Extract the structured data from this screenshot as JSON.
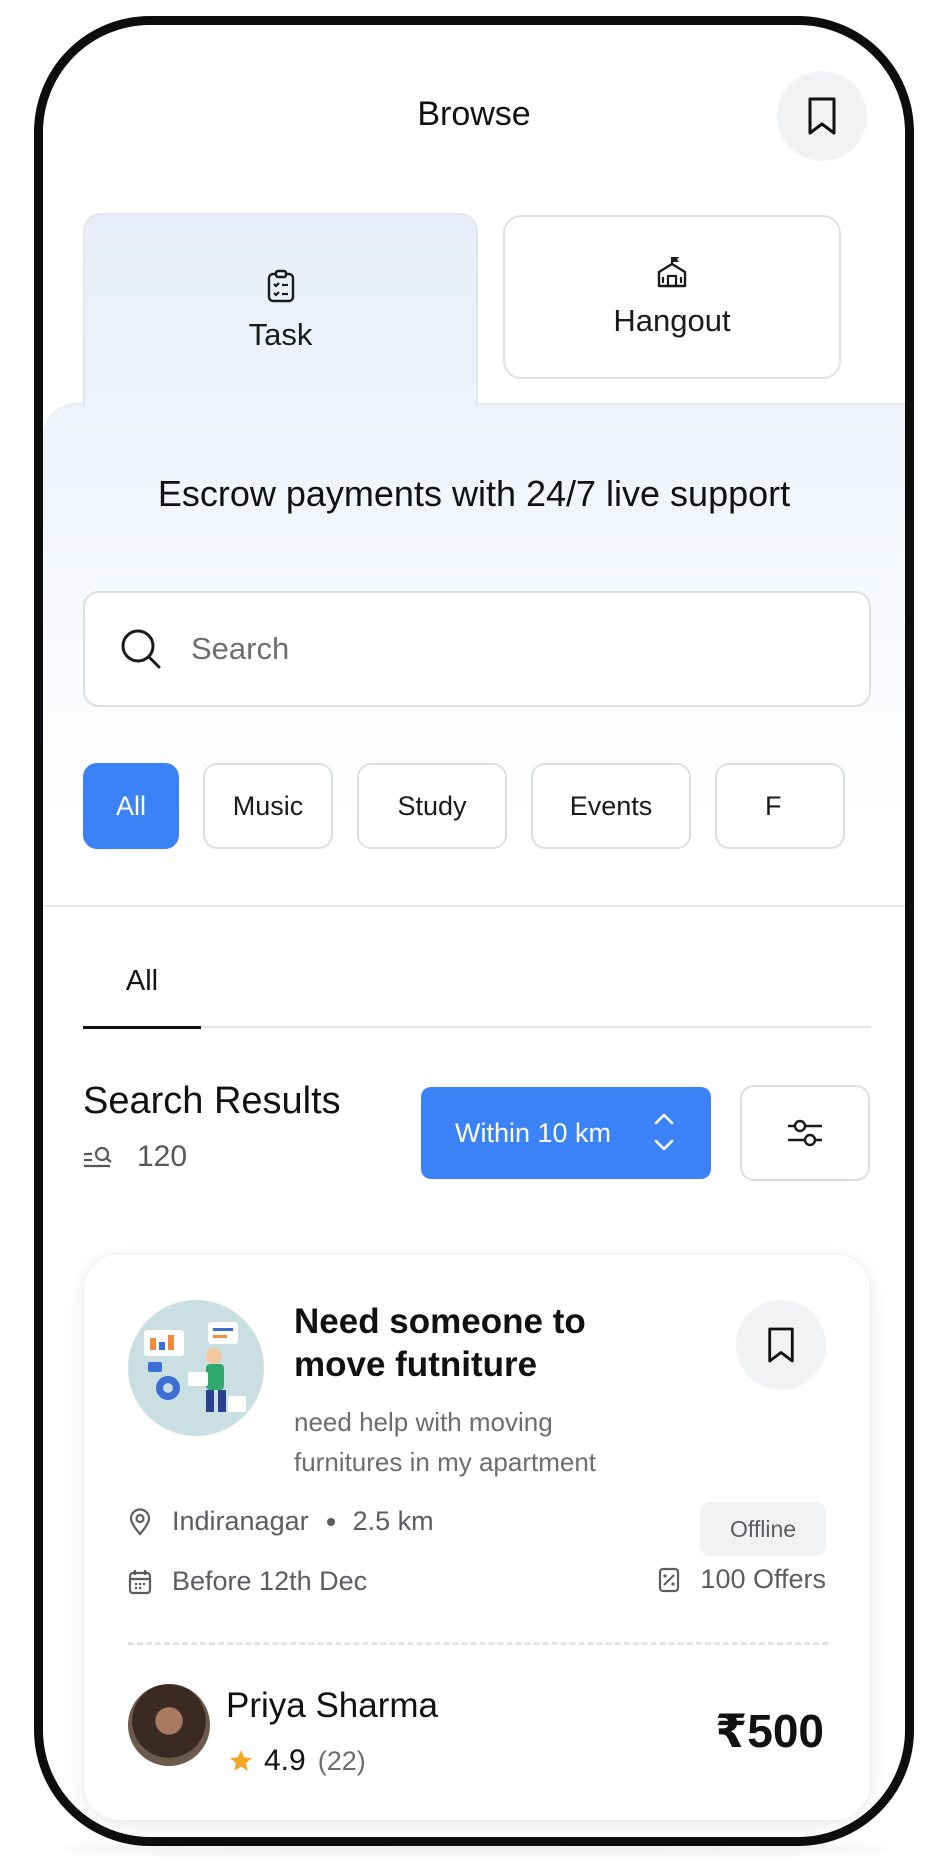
{
  "header": {
    "title": "Browse"
  },
  "tabs": [
    {
      "label": "Task",
      "icon": "clipboard-checklist-icon",
      "active": true
    },
    {
      "label": "Hangout",
      "icon": "building-flag-icon",
      "active": false
    }
  ],
  "banner": {
    "text": "Escrow payments with 24/7 live support"
  },
  "search": {
    "placeholder": "Search",
    "value": ""
  },
  "categories": [
    {
      "label": "All",
      "active": true
    },
    {
      "label": "Music",
      "active": false
    },
    {
      "label": "Study",
      "active": false
    },
    {
      "label": "Events",
      "active": false
    },
    {
      "label": "F",
      "active": false
    }
  ],
  "subtabs": [
    {
      "label": "All",
      "active": true
    }
  ],
  "results": {
    "title": "Search Results",
    "count": "120",
    "distance_filter": "Within 10 km"
  },
  "card": {
    "title": "Need someone to move futniture",
    "description": "need help with moving furnitures in my apartment",
    "status": "Offline",
    "location": "Indiranagar",
    "distance": "2.5 km",
    "deadline": "Before 12th Dec",
    "offers": "100 Offers",
    "poster": {
      "name": "Priya Sharma",
      "rating": "4.9",
      "reviews": "(22)"
    },
    "price": "₹500"
  },
  "colors": {
    "accent": "#3b82f6",
    "star": "#f5a623",
    "text": "#111111",
    "muted": "#5a5d62"
  }
}
